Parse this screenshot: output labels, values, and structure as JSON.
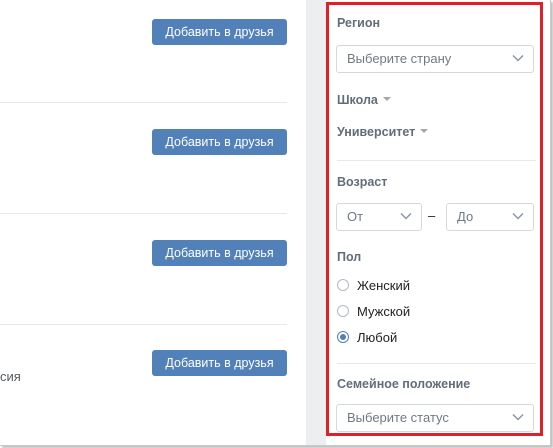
{
  "results": {
    "add_button_label": "Добавить в друзья",
    "rows": [
      {
        "button": "Добавить в друзья",
        "fragment": ""
      },
      {
        "button": "Добавить в друзья",
        "fragment": ""
      },
      {
        "button": "Добавить в друзья",
        "fragment": ""
      },
      {
        "button": "Добавить в друзья",
        "fragment": "сия"
      }
    ]
  },
  "filters": {
    "region": {
      "label": "Регион",
      "placeholder": "Выберите страну"
    },
    "school": {
      "label": "Школа"
    },
    "university": {
      "label": "Университет"
    },
    "age": {
      "label": "Возраст",
      "from": "От",
      "separator": "–",
      "to": "До"
    },
    "gender": {
      "label": "Пол",
      "options": [
        {
          "label": "Женский",
          "checked": false
        },
        {
          "label": "Мужской",
          "checked": false
        },
        {
          "label": "Любой",
          "checked": true
        }
      ]
    },
    "marital": {
      "label": "Семейное положение",
      "placeholder": "Выберите статус"
    }
  },
  "colors": {
    "accent": "#5181b8",
    "highlight_border": "#e21f26",
    "panel_gap": "#edeef0",
    "divider": "#e7e8ec"
  },
  "icons": {
    "dropdown": "chevron-down-icon",
    "collapse": "caret-down-icon"
  }
}
